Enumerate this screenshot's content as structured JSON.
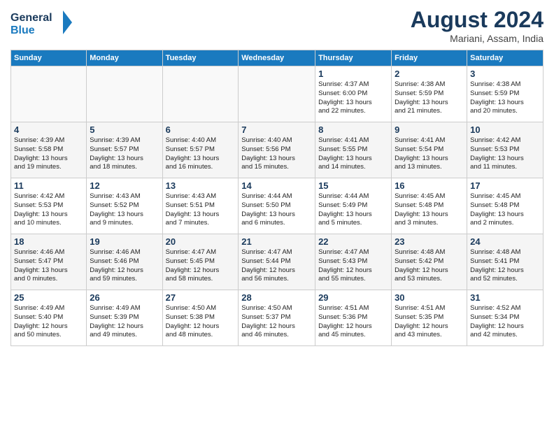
{
  "header": {
    "logo_line1": "General",
    "logo_line2": "Blue",
    "month_year": "August 2024",
    "location": "Mariani, Assam, India"
  },
  "days_of_week": [
    "Sunday",
    "Monday",
    "Tuesday",
    "Wednesday",
    "Thursday",
    "Friday",
    "Saturday"
  ],
  "weeks": [
    [
      {
        "day": "",
        "info": ""
      },
      {
        "day": "",
        "info": ""
      },
      {
        "day": "",
        "info": ""
      },
      {
        "day": "",
        "info": ""
      },
      {
        "day": "1",
        "info": "Sunrise: 4:37 AM\nSunset: 6:00 PM\nDaylight: 13 hours\nand 22 minutes."
      },
      {
        "day": "2",
        "info": "Sunrise: 4:38 AM\nSunset: 5:59 PM\nDaylight: 13 hours\nand 21 minutes."
      },
      {
        "day": "3",
        "info": "Sunrise: 4:38 AM\nSunset: 5:59 PM\nDaylight: 13 hours\nand 20 minutes."
      }
    ],
    [
      {
        "day": "4",
        "info": "Sunrise: 4:39 AM\nSunset: 5:58 PM\nDaylight: 13 hours\nand 19 minutes."
      },
      {
        "day": "5",
        "info": "Sunrise: 4:39 AM\nSunset: 5:57 PM\nDaylight: 13 hours\nand 18 minutes."
      },
      {
        "day": "6",
        "info": "Sunrise: 4:40 AM\nSunset: 5:57 PM\nDaylight: 13 hours\nand 16 minutes."
      },
      {
        "day": "7",
        "info": "Sunrise: 4:40 AM\nSunset: 5:56 PM\nDaylight: 13 hours\nand 15 minutes."
      },
      {
        "day": "8",
        "info": "Sunrise: 4:41 AM\nSunset: 5:55 PM\nDaylight: 13 hours\nand 14 minutes."
      },
      {
        "day": "9",
        "info": "Sunrise: 4:41 AM\nSunset: 5:54 PM\nDaylight: 13 hours\nand 13 minutes."
      },
      {
        "day": "10",
        "info": "Sunrise: 4:42 AM\nSunset: 5:53 PM\nDaylight: 13 hours\nand 11 minutes."
      }
    ],
    [
      {
        "day": "11",
        "info": "Sunrise: 4:42 AM\nSunset: 5:53 PM\nDaylight: 13 hours\nand 10 minutes."
      },
      {
        "day": "12",
        "info": "Sunrise: 4:43 AM\nSunset: 5:52 PM\nDaylight: 13 hours\nand 9 minutes."
      },
      {
        "day": "13",
        "info": "Sunrise: 4:43 AM\nSunset: 5:51 PM\nDaylight: 13 hours\nand 7 minutes."
      },
      {
        "day": "14",
        "info": "Sunrise: 4:44 AM\nSunset: 5:50 PM\nDaylight: 13 hours\nand 6 minutes."
      },
      {
        "day": "15",
        "info": "Sunrise: 4:44 AM\nSunset: 5:49 PM\nDaylight: 13 hours\nand 5 minutes."
      },
      {
        "day": "16",
        "info": "Sunrise: 4:45 AM\nSunset: 5:48 PM\nDaylight: 13 hours\nand 3 minutes."
      },
      {
        "day": "17",
        "info": "Sunrise: 4:45 AM\nSunset: 5:48 PM\nDaylight: 13 hours\nand 2 minutes."
      }
    ],
    [
      {
        "day": "18",
        "info": "Sunrise: 4:46 AM\nSunset: 5:47 PM\nDaylight: 13 hours\nand 0 minutes."
      },
      {
        "day": "19",
        "info": "Sunrise: 4:46 AM\nSunset: 5:46 PM\nDaylight: 12 hours\nand 59 minutes."
      },
      {
        "day": "20",
        "info": "Sunrise: 4:47 AM\nSunset: 5:45 PM\nDaylight: 12 hours\nand 58 minutes."
      },
      {
        "day": "21",
        "info": "Sunrise: 4:47 AM\nSunset: 5:44 PM\nDaylight: 12 hours\nand 56 minutes."
      },
      {
        "day": "22",
        "info": "Sunrise: 4:47 AM\nSunset: 5:43 PM\nDaylight: 12 hours\nand 55 minutes."
      },
      {
        "day": "23",
        "info": "Sunrise: 4:48 AM\nSunset: 5:42 PM\nDaylight: 12 hours\nand 53 minutes."
      },
      {
        "day": "24",
        "info": "Sunrise: 4:48 AM\nSunset: 5:41 PM\nDaylight: 12 hours\nand 52 minutes."
      }
    ],
    [
      {
        "day": "25",
        "info": "Sunrise: 4:49 AM\nSunset: 5:40 PM\nDaylight: 12 hours\nand 50 minutes."
      },
      {
        "day": "26",
        "info": "Sunrise: 4:49 AM\nSunset: 5:39 PM\nDaylight: 12 hours\nand 49 minutes."
      },
      {
        "day": "27",
        "info": "Sunrise: 4:50 AM\nSunset: 5:38 PM\nDaylight: 12 hours\nand 48 minutes."
      },
      {
        "day": "28",
        "info": "Sunrise: 4:50 AM\nSunset: 5:37 PM\nDaylight: 12 hours\nand 46 minutes."
      },
      {
        "day": "29",
        "info": "Sunrise: 4:51 AM\nSunset: 5:36 PM\nDaylight: 12 hours\nand 45 minutes."
      },
      {
        "day": "30",
        "info": "Sunrise: 4:51 AM\nSunset: 5:35 PM\nDaylight: 12 hours\nand 43 minutes."
      },
      {
        "day": "31",
        "info": "Sunrise: 4:52 AM\nSunset: 5:34 PM\nDaylight: 12 hours\nand 42 minutes."
      }
    ]
  ]
}
